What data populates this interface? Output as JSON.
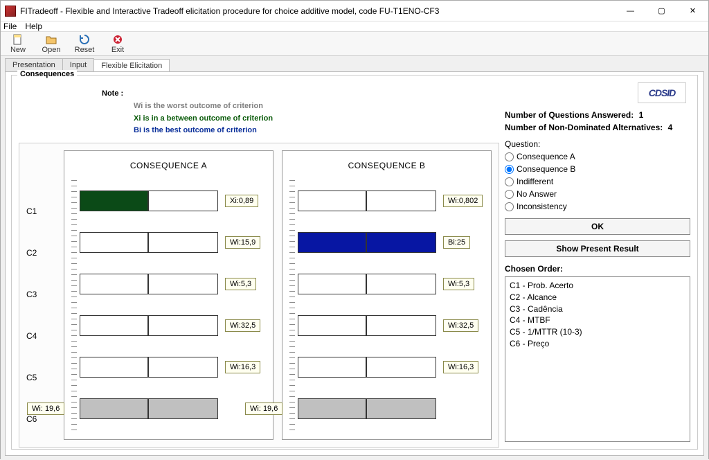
{
  "window": {
    "title": "FITradeoff - Flexible and Interactive Tradeoff elicitation  procedure for choice additive model, code FU-T1ENO-CF3"
  },
  "menu": {
    "file": "File",
    "help": "Help"
  },
  "toolbar": {
    "new": "New",
    "open": "Open",
    "reset": "Reset",
    "exit": "Exit"
  },
  "tabs": {
    "presentation": "Presentation",
    "input": "Input",
    "flex": "Flexible Elicitation"
  },
  "group_title": "Consequences",
  "note": {
    "label": "Note :",
    "wi": "Wi is the worst outcome of criterion",
    "xi": "Xi is in a between outcome of criterion",
    "bi": "Bi is the best outcome of criterion"
  },
  "crit_labels": [
    "C1",
    "C2",
    "C3",
    "C4",
    "C5",
    "C6"
  ],
  "consequence_a": {
    "title": "CONSEQUENCE A",
    "rows": [
      {
        "badge": "Xi:0,89",
        "badge_side": "right",
        "fill_pct": 50,
        "fill_color": "green",
        "bar_gray": false
      },
      {
        "badge": "Wi:15,9",
        "badge_side": "right",
        "fill_pct": 0,
        "fill_color": "",
        "bar_gray": false
      },
      {
        "badge": "Wi:5,3",
        "badge_side": "right",
        "fill_pct": 0,
        "fill_color": "",
        "bar_gray": false
      },
      {
        "badge": "Wi:32,5",
        "badge_side": "right",
        "fill_pct": 0,
        "fill_color": "",
        "bar_gray": false
      },
      {
        "badge": "Wi:16,3",
        "badge_side": "right",
        "fill_pct": 0,
        "fill_color": "",
        "bar_gray": false
      },
      {
        "badge": "Wi: 19,6",
        "badge_side": "left",
        "fill_pct": 0,
        "fill_color": "",
        "bar_gray": true
      }
    ]
  },
  "consequence_b": {
    "title": "CONSEQUENCE B",
    "rows": [
      {
        "badge": "Wi:0,802",
        "badge_side": "right",
        "fill_pct": 0,
        "fill_color": "",
        "bar_gray": false
      },
      {
        "badge": "Bi:25",
        "badge_side": "right",
        "fill_pct": 100,
        "fill_color": "blue",
        "bar_gray": false
      },
      {
        "badge": "Wi:5,3",
        "badge_side": "right",
        "fill_pct": 0,
        "fill_color": "",
        "bar_gray": false
      },
      {
        "badge": "Wi:32,5",
        "badge_side": "right",
        "fill_pct": 0,
        "fill_color": "",
        "bar_gray": false
      },
      {
        "badge": "Wi:16,3",
        "badge_side": "right",
        "fill_pct": 0,
        "fill_color": "",
        "bar_gray": false
      },
      {
        "badge": "Wi: 19,6",
        "badge_side": "left",
        "fill_pct": 0,
        "fill_color": "",
        "bar_gray": true
      }
    ]
  },
  "right": {
    "logo": "CDSID",
    "q_answered_label": "Number of Questions Answered:",
    "q_answered_value": "1",
    "nondom_label": "Number of Non-Dominated Alternatives:",
    "nondom_value": "4",
    "question_label": "Question:",
    "opts": {
      "a": "Consequence A",
      "b": "Consequence B",
      "ind": "Indifferent",
      "noanswer": "No Answer",
      "incons": "Inconsistency"
    },
    "selected_opt": "b",
    "ok": "OK",
    "show_result": "Show Present Result",
    "chosen_header": "Chosen Order:",
    "chosen_order": [
      "C1 - Prob. Acerto",
      "C2 - Alcance",
      "C3 - Cadência",
      "C4 - MTBF",
      "C5 - 1/MTTR (10-3)",
      "C6 - Preço"
    ]
  },
  "chart_data": {
    "type": "bar",
    "note": "Two consequence profiles over 6 criteria. Bars show relative position between worst (Wi) and best (Bi) per criterion; numeric labels are the raw outcome values as shown next to each bar.",
    "criteria": [
      "C1",
      "C2",
      "C3",
      "C4",
      "C5",
      "C6"
    ],
    "series": [
      {
        "name": "Consequence A",
        "values_label": [
          "Xi:0,89",
          "Wi:15,9",
          "Wi:5,3",
          "Wi:32,5",
          "Wi:16,3",
          "Wi: 19,6"
        ],
        "fill_proportion": [
          0.5,
          0,
          0,
          0,
          0,
          0
        ]
      },
      {
        "name": "Consequence B",
        "values_label": [
          "Wi:0,802",
          "Bi:25",
          "Wi:5,3",
          "Wi:32,5",
          "Wi:16,3",
          "Wi: 19,6"
        ],
        "fill_proportion": [
          0,
          1.0,
          0,
          0,
          0,
          0
        ]
      }
    ]
  }
}
